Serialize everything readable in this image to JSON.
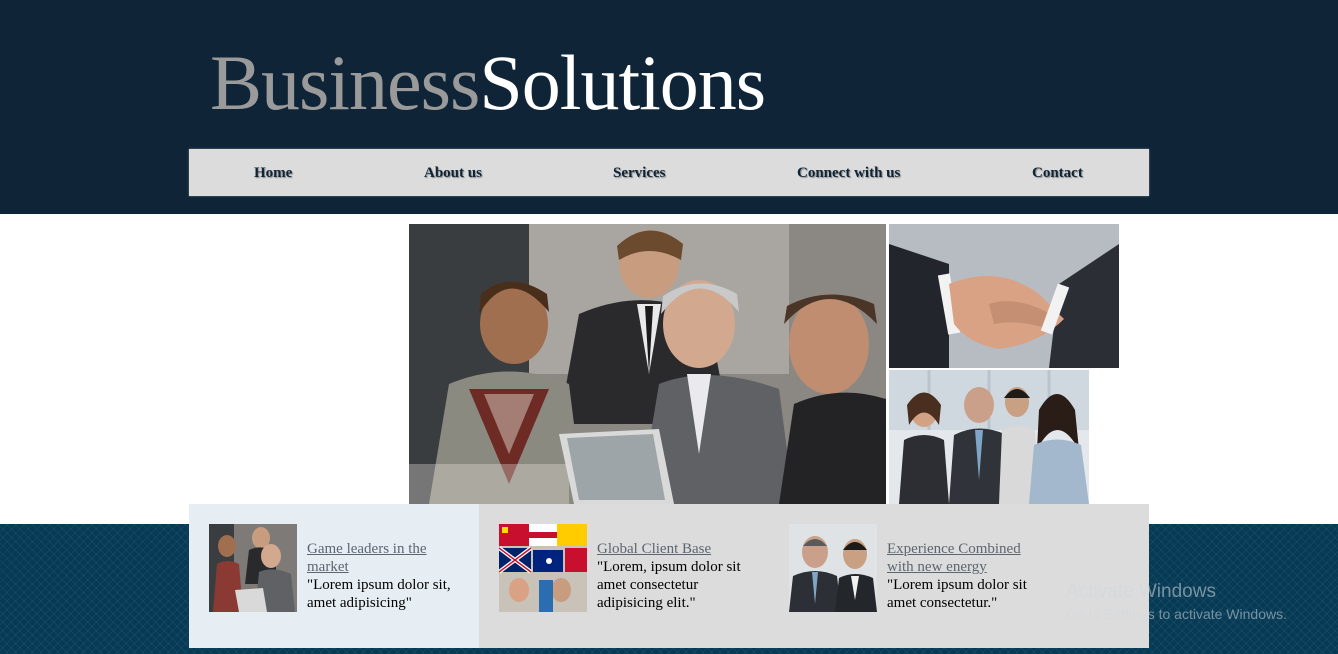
{
  "logo": {
    "part1": "Business",
    "part2": "Solutions"
  },
  "nav": {
    "items": [
      {
        "label": "Home"
      },
      {
        "label": "About us"
      },
      {
        "label": "Services"
      },
      {
        "label": "Connect with us"
      },
      {
        "label": "Contact"
      }
    ]
  },
  "features": [
    {
      "title": "Game leaders in the market",
      "text": "\"Lorem ipsum dolor sit, amet adipisicing\""
    },
    {
      "title": "Global Client Base",
      "text": "\"Lorem, ipsum dolor sit amet consectetur adipisicing elit.\""
    },
    {
      "title": "Experience Combined with new energy",
      "text": "\"Lorem ipsum dolor sit amet consectetur.\""
    }
  ],
  "watermark": {
    "line1": "Activate Windows",
    "line2": "Go to Settings to activate Windows."
  },
  "colors": {
    "header_bg": "#0f2537",
    "nav_bg": "#dcdcdc",
    "footer_band": "#063a55",
    "logo_grey": "#9a9a9a"
  }
}
